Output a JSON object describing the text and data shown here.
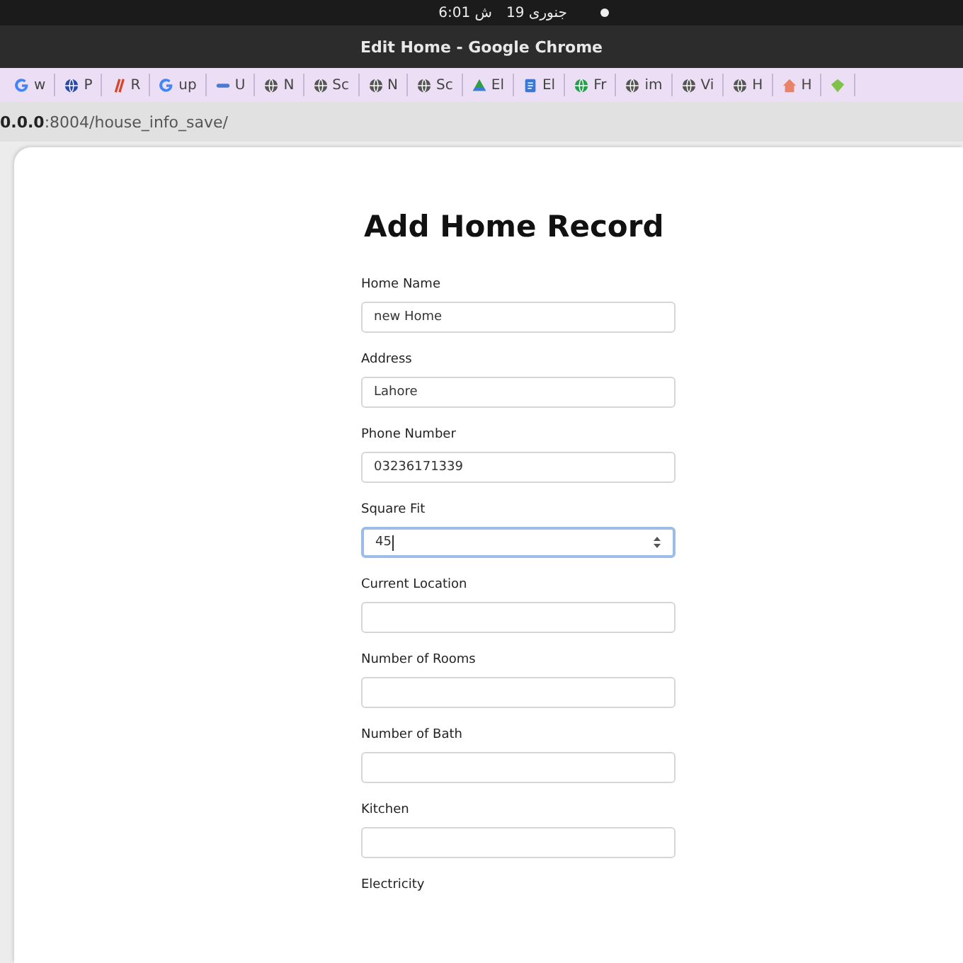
{
  "top_bar": {
    "date": "جنوری 19",
    "time": "6:01 ش"
  },
  "window": {
    "title": "Edit Home - Google Chrome"
  },
  "bookmarks": [
    {
      "kind": "google",
      "label": "w"
    },
    {
      "kind": "globe",
      "color": "#2b4aa8",
      "label": "P"
    },
    {
      "kind": "slashes",
      "color": "#d9452b",
      "label": "R"
    },
    {
      "kind": "google",
      "label": "up"
    },
    {
      "kind": "bar",
      "color": "#4a7bd0",
      "label": "U"
    },
    {
      "kind": "globe",
      "color": "#555555",
      "label": "N"
    },
    {
      "kind": "globe",
      "color": "#555555",
      "label": "Sc"
    },
    {
      "kind": "globe",
      "color": "#555555",
      "label": "N"
    },
    {
      "kind": "globe",
      "color": "#555555",
      "label": "Sc"
    },
    {
      "kind": "triangle",
      "color": "#2f9e44",
      "label": "El"
    },
    {
      "kind": "doc",
      "color": "#3a78d6",
      "label": "El"
    },
    {
      "kind": "globe",
      "color": "#21a04a",
      "label": "Fr"
    },
    {
      "kind": "globe",
      "color": "#555555",
      "label": "im"
    },
    {
      "kind": "globe",
      "color": "#555555",
      "label": "Vi"
    },
    {
      "kind": "globe",
      "color": "#555555",
      "label": "H"
    },
    {
      "kind": "house",
      "color": "#e8836a",
      "label": "H"
    },
    {
      "kind": "diamond",
      "color": "#7fc24a"
    }
  ],
  "address_bar": {
    "host": "0.0.0",
    "path": ":8004/house_info_save/"
  },
  "form": {
    "title": "Add Home Record",
    "fields": [
      {
        "label": "Home Name",
        "kind": "text",
        "value": "new Home",
        "focused": false
      },
      {
        "label": "Address",
        "kind": "text",
        "value": "Lahore",
        "focused": false
      },
      {
        "label": "Phone Number",
        "kind": "text",
        "value": "03236171339",
        "focused": false
      },
      {
        "label": "Square Fit",
        "kind": "number",
        "value": "45",
        "focused": true
      },
      {
        "label": "Current Location",
        "kind": "text",
        "focused": false
      },
      {
        "label": "Number of Rooms",
        "kind": "text",
        "focused": false
      },
      {
        "label": "Number of Bath",
        "kind": "text",
        "focused": false
      },
      {
        "label": "Kitchen",
        "kind": "text",
        "focused": false
      },
      {
        "label": "Electricity",
        "kind": "label"
      }
    ]
  }
}
